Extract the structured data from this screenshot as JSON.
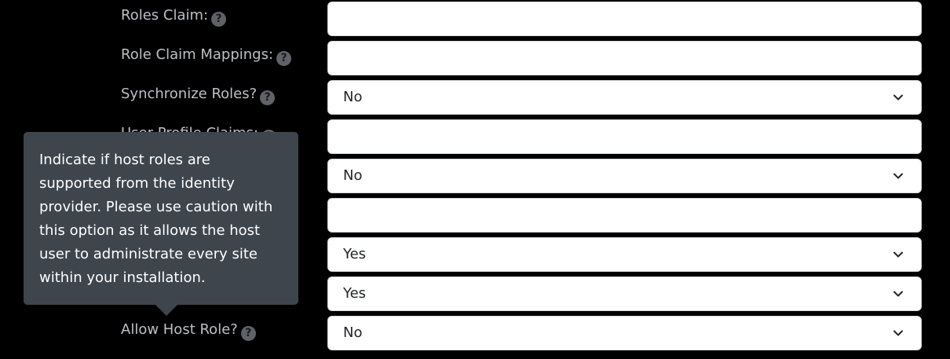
{
  "fields": {
    "roles_claim": {
      "label": "Roles Claim:",
      "value": ""
    },
    "role_claim_mappings": {
      "label": "Role Claim Mappings:",
      "value": ""
    },
    "synchronize_roles": {
      "label": "Synchronize Roles?",
      "value": "No"
    },
    "user_profile_claims": {
      "label": "User Profile Claims:",
      "value": ""
    },
    "select_row_5": {
      "value": "No"
    },
    "text_row_6": {
      "value": ""
    },
    "select_row_7": {
      "value": "Yes"
    },
    "select_row_8": {
      "value": "Yes"
    },
    "allow_host_role": {
      "label": "Allow Host Role?",
      "value": "No"
    }
  },
  "tooltip": {
    "text": "Indicate if host roles are supported from the identity provider. Please use caution with this option as it allows the host user to administrate every site within your installation."
  },
  "icons": {
    "help": "question-mark-circle-icon",
    "chevron": "chevron-down-icon"
  },
  "colors": {
    "background": "#000000",
    "label_text": "#bcc0c4",
    "tooltip_bg": "#3e454d",
    "control_bg": "#ffffff"
  }
}
